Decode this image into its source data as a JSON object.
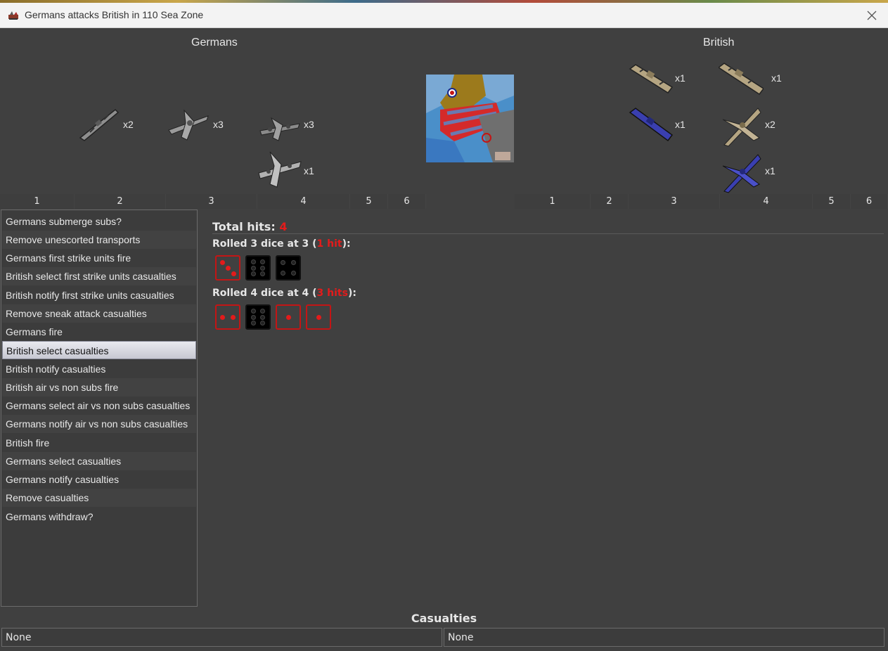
{
  "window": {
    "title": "Germans attacks British in 110 Sea Zone",
    "close_icon": "close-icon",
    "app_icon": "triplea-icon"
  },
  "attacker": {
    "name": "Germans",
    "units": [
      {
        "type": "battleship-icon",
        "count": "x2"
      },
      {
        "type": "fighter-icon",
        "count": "x3"
      },
      {
        "type": "tactical-bomber-icon",
        "count": "x3"
      },
      {
        "type": "bomber-icon",
        "count": "x1"
      }
    ],
    "axis": [
      "1",
      "2",
      "3",
      "4",
      "5",
      "6"
    ]
  },
  "defender": {
    "name": "British",
    "units": [
      {
        "type": "battleship-icon",
        "count": "x1",
        "color": "#b5a582"
      },
      {
        "type": "cruiser-icon",
        "count": "x1",
        "color": "#b5a582"
      },
      {
        "type": "destroyer-icon",
        "count": "x1",
        "color": "#3a3fb0"
      },
      {
        "type": "fighter-icon",
        "count": "x2",
        "color": "#b5a582"
      },
      {
        "type": "fighter-icon",
        "count": "x1",
        "color": "#3a3fb0"
      }
    ],
    "axis": [
      "1",
      "2",
      "3",
      "4",
      "5",
      "6"
    ]
  },
  "steps": [
    "Germans submerge subs?",
    "Remove unescorted transports",
    "Germans first strike units fire",
    "British select first strike units casualties",
    "British notify first strike units casualties",
    "Remove sneak attack casualties",
    "Germans fire",
    "British select casualties",
    "British notify casualties",
    "British air vs non subs fire",
    "Germans select air vs non subs casualties",
    "Germans notify air vs non subs casualties",
    "British fire",
    "Germans select casualties",
    "Germans notify casualties",
    "Remove casualties",
    "Germans withdraw?"
  ],
  "selected_step": 7,
  "results": {
    "total_label": "Total hits:",
    "total_value": "4",
    "rolls": [
      {
        "prefix": "Rolled 3 dice at 3 (",
        "hits": "1 hit",
        "suffix": "):",
        "dice": [
          3,
          6,
          4
        ],
        "hits_flags": [
          true,
          false,
          false
        ]
      },
      {
        "prefix": "Rolled 4 dice at 4 (",
        "hits": "3 hits",
        "suffix": "):",
        "dice": [
          2,
          6,
          1,
          1
        ],
        "hits_flags": [
          true,
          false,
          true,
          true
        ]
      }
    ]
  },
  "casualties": {
    "title": "Casualties",
    "left": "None",
    "right": "None"
  },
  "colors": {
    "hit": "#e31b1b",
    "german_unit": "#9a9a9a",
    "british_tan": "#b5a582",
    "british_blue": "#3a3fb0"
  }
}
